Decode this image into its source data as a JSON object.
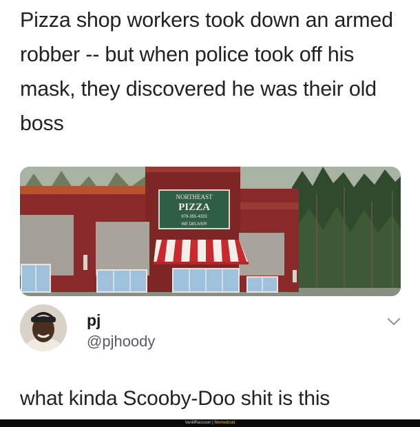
{
  "post": {
    "headline": "Pizza shop workers took down an armed robber -- but when police took off his mask, they discovered he was their old boss"
  },
  "photo": {
    "sign_lines": [
      "NORTHEAST",
      "PIZZA",
      "978-355-4333",
      "WE DELIVER"
    ]
  },
  "reply": {
    "author_name": "pj",
    "author_handle": "@pjhoody",
    "text": "what kinda Scooby-Doo shit is this",
    "menu_icon": "chevron-down-icon"
  },
  "watermark": {
    "site": "VanillRaccoon",
    "separator": " | ",
    "app": "Memedroid"
  },
  "colors": {
    "text": "#222222",
    "handle": "#555c63",
    "building_red": "#8a2a2a",
    "awning_red": "#c62a2f",
    "sign_green": "#2f5e46"
  }
}
